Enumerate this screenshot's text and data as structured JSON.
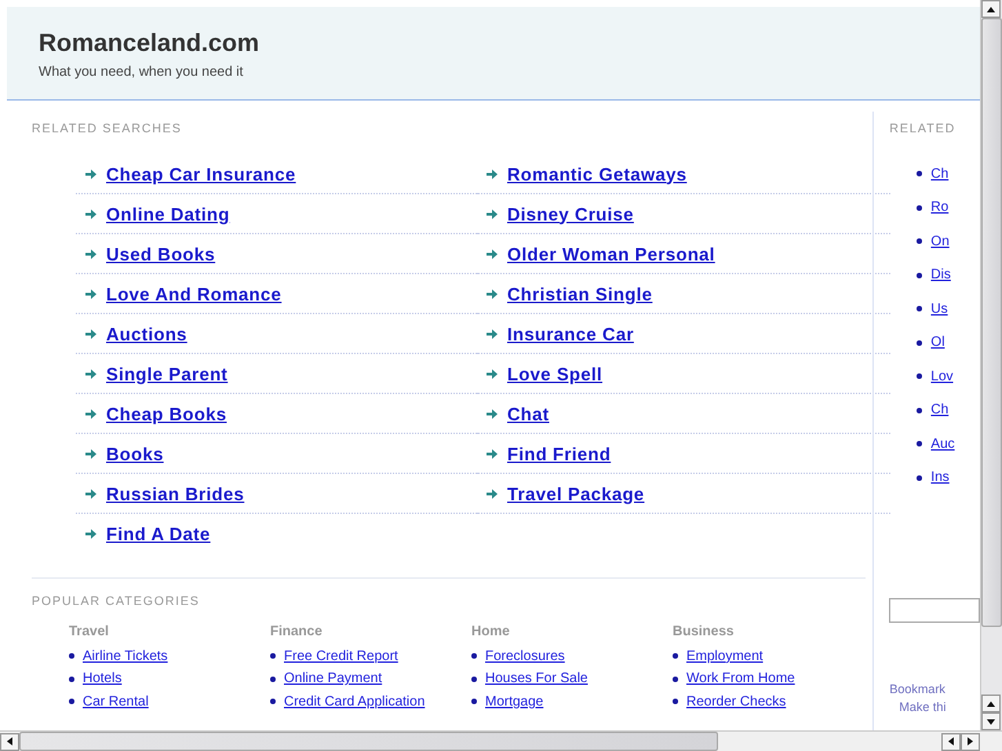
{
  "header": {
    "title": "Romanceland.com",
    "tagline": "What you need, when you need it"
  },
  "related_searches": {
    "heading": "RELATED SEARCHES",
    "columns": [
      [
        "Cheap Car Insurance",
        "Online Dating",
        "Used Books",
        "Love And Romance",
        "Auctions",
        "Single Parent",
        "Cheap Books",
        "Books",
        "Russian Brides",
        "Find A Date"
      ],
      [
        "Romantic Getaways",
        "Disney Cruise",
        "Older Woman Personal",
        "Christian Single",
        "Insurance Car",
        "Love Spell",
        "Chat",
        "Find Friend",
        "Travel Package"
      ]
    ]
  },
  "popular_categories": {
    "heading": "POPULAR CATEGORIES",
    "groups": [
      {
        "title": "Travel",
        "links": [
          "Airline Tickets",
          "Hotels",
          "Car Rental"
        ]
      },
      {
        "title": "Finance",
        "links": [
          "Free Credit Report",
          "Online Payment",
          "Credit Card Application"
        ]
      },
      {
        "title": "Home",
        "links": [
          "Foreclosures",
          "Houses For Sale",
          "Mortgage"
        ]
      },
      {
        "title": "Business",
        "links": [
          "Employment",
          "Work From Home",
          "Reorder Checks"
        ]
      }
    ]
  },
  "sidebar": {
    "heading": "RELATED",
    "links": [
      "Ch",
      "Ro",
      "On",
      "Dis",
      "Us",
      "Ol",
      "Lov",
      "Ch",
      "Auc",
      "Ins"
    ],
    "bookmark": "Bookmark",
    "make": "Make thi"
  }
}
